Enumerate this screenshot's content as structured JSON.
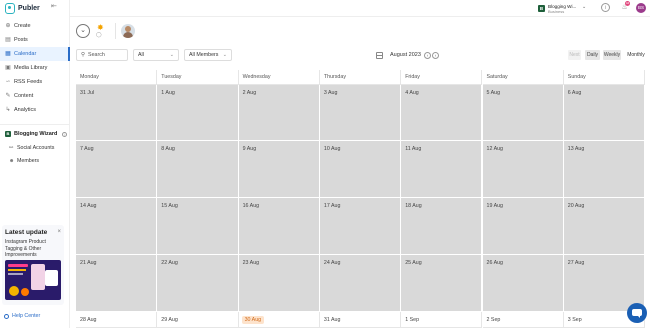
{
  "app": {
    "brand": "Publer"
  },
  "sidebar": {
    "nav": [
      {
        "label": "Create",
        "icon": "plus-icon"
      },
      {
        "label": "Posts",
        "icon": "posts-icon"
      },
      {
        "label": "Calendar",
        "icon": "calendar-icon",
        "active": true
      },
      {
        "label": "Media Library",
        "icon": "image-icon"
      },
      {
        "label": "RSS Feeds",
        "icon": "rss-icon"
      },
      {
        "label": "Content",
        "icon": "content-icon"
      },
      {
        "label": "Analytics",
        "icon": "chart-icon"
      }
    ],
    "workspace": {
      "badge": "B",
      "name": "Blogging Wizard",
      "items": [
        {
          "label": "Social Accounts",
          "icon": "accounts-icon"
        },
        {
          "label": "Members",
          "icon": "members-icon"
        }
      ]
    },
    "update_card": {
      "title": "Latest update",
      "text": "Instagram Product Tagging & Other Improvements"
    },
    "help_label": "Help Center"
  },
  "topbar": {
    "account_badge": "B",
    "account_name": "Blogging Wi...",
    "account_plan": "Business",
    "notification_count": "44",
    "user_initials": "BS"
  },
  "filters": {
    "search_placeholder": "Search",
    "network_select": "All",
    "members_select": "All Members",
    "month_label": "August 2023",
    "views": [
      "Next",
      "Daily",
      "Weekly",
      "Monthly"
    ],
    "active_view": "Monthly"
  },
  "calendar": {
    "days": [
      "Monday",
      "Tuesday",
      "Wednesday",
      "Thursday",
      "Friday",
      "Saturday",
      "Sunday"
    ],
    "weeks": [
      [
        "31 Jul",
        "1 Aug",
        "2 Aug",
        "3 Aug",
        "4 Aug",
        "5 Aug",
        "6 Aug"
      ],
      [
        "7 Aug",
        "8 Aug",
        "9 Aug",
        "10 Aug",
        "11 Aug",
        "12 Aug",
        "13 Aug"
      ],
      [
        "14 Aug",
        "15 Aug",
        "16 Aug",
        "17 Aug",
        "18 Aug",
        "19 Aug",
        "20 Aug"
      ],
      [
        "21 Aug",
        "22 Aug",
        "23 Aug",
        "24 Aug",
        "25 Aug",
        "26 Aug",
        "27 Aug"
      ],
      [
        "28 Aug",
        "29 Aug",
        "30 Aug",
        "31 Aug",
        "1 Sep",
        "2 Sep",
        "3 Sep"
      ]
    ],
    "today": "30 Aug",
    "colors": {
      "past_cell": "#d9d9d9",
      "today_bg": "#fde3cc",
      "today_text": "#d06a1a",
      "accent": "#2a6cc7"
    }
  }
}
